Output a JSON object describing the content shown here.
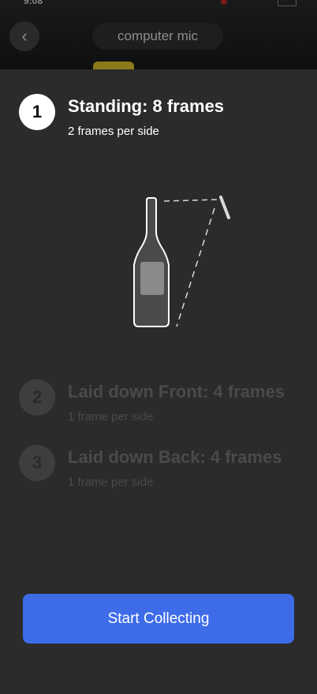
{
  "header": {
    "status_time": "9:08",
    "title": "computer mic"
  },
  "steps": [
    {
      "number": "1",
      "title": "Standing: 8 frames",
      "subtitle": "2 frames per side",
      "state": "active"
    },
    {
      "number": "2",
      "title": "Laid down Front: 4 frames",
      "subtitle": "1 frame per side",
      "state": "inactive"
    },
    {
      "number": "3",
      "title": "Laid down Back: 4 frames",
      "subtitle": "1 frame per side",
      "state": "inactive"
    }
  ],
  "illustration": {
    "icon": "bottle-standing-icon"
  },
  "actions": {
    "start_label": "Start Collecting"
  },
  "colors": {
    "accent": "#3e6ce8",
    "sheet": "#2b2b2b"
  }
}
